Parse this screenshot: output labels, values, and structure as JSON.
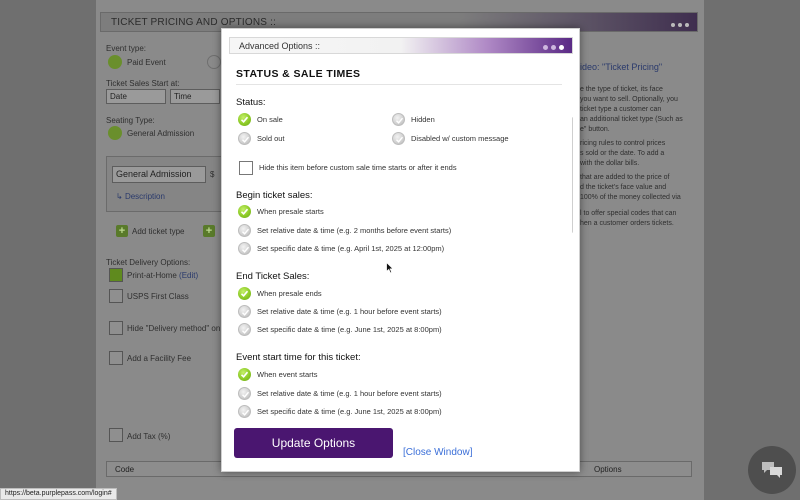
{
  "background": {
    "header_title": "TICKET PRICING AND OPTIONS ::",
    "event_type_label": "Event type:",
    "paid_event": "Paid Event",
    "ticket_sales_start_label": "Ticket Sales Start at:",
    "date_select": "Date",
    "time_select": "Time",
    "seating_type_label": "Seating Type:",
    "general_admission": "General Admission",
    "ticket_name_select": "General Admission",
    "currency_symbol": "$",
    "description": "Description",
    "add_ticket_type": "Add ticket type",
    "delivery_options_label": "Ticket Delivery Options:",
    "print_at_home": "Print-at-Home",
    "edit_link": "(Edit)",
    "usps_first_class": "USPS First Class",
    "hide_delivery": "Hide \"Delivery method\" on s",
    "add_facility_fee": "Add a Facility Fee",
    "add_tax": "Add Tax (%)",
    "video_link": "ideo: \"Ticket Pricing\"",
    "right_help_lines": [
      "e the type of ticket, its face",
      "you want to sell. Optionally, you",
      "ticket type a customer can",
      "an additional ticket type (Such as",
      "e\" button.",
      "",
      "ricing rules to control prices",
      "s sold or the date. To add a",
      "with the dollar bills.",
      "",
      "that are added to the price of",
      "d the ticket's face value and",
      "100% of the money collected via",
      "",
      "l to offer special codes that can",
      "hen a customer orders tickets."
    ],
    "table_col_code": "Code",
    "table_col_options": "Options"
  },
  "modal": {
    "title": "Advanced Options ::",
    "section_title": "STATUS & SALE TIMES",
    "status_label": "Status:",
    "status_options": [
      {
        "label": "On sale",
        "selected": true
      },
      {
        "label": "Hidden",
        "selected": false
      },
      {
        "label": "Sold out",
        "selected": false
      },
      {
        "label": "Disabled w/ custom message",
        "selected": false
      }
    ],
    "hide_checkbox_label": "Hide this item before custom sale time starts or after it ends",
    "begin_label": "Begin ticket sales:",
    "begin_options": [
      {
        "label": "When presale starts",
        "selected": true
      },
      {
        "label": "Set relative date & time (e.g. 2 months before event starts)",
        "selected": false
      },
      {
        "label": "Set specific date & time (e.g. April 1st, 2025 at 12:00pm)",
        "selected": false
      }
    ],
    "end_label": "End Ticket Sales:",
    "end_options": [
      {
        "label": "When presale ends",
        "selected": true
      },
      {
        "label": "Set relative date & time (e.g. 1 hour before event starts)",
        "selected": false
      },
      {
        "label": "Set specific date & time (e.g. June 1st, 2025 at 8:00pm)",
        "selected": false
      }
    ],
    "event_start_label": "Event start time for this ticket:",
    "event_start_options": [
      {
        "label": "When event starts",
        "selected": true
      },
      {
        "label": "Set relative date & time (e.g. 1 hour before event starts)",
        "selected": false
      },
      {
        "label": "Set specific date & time (e.g. June 1st, 2025 at 8:00pm)",
        "selected": false
      }
    ],
    "update_button": "Update Options",
    "close_link": "[Close Window]"
  },
  "status_bar_url": "https://beta.purplepass.com/login#",
  "colors": {
    "accent_purple": "#4a1670",
    "radio_green": "#8cca26",
    "link_blue": "#3b6fd8"
  }
}
